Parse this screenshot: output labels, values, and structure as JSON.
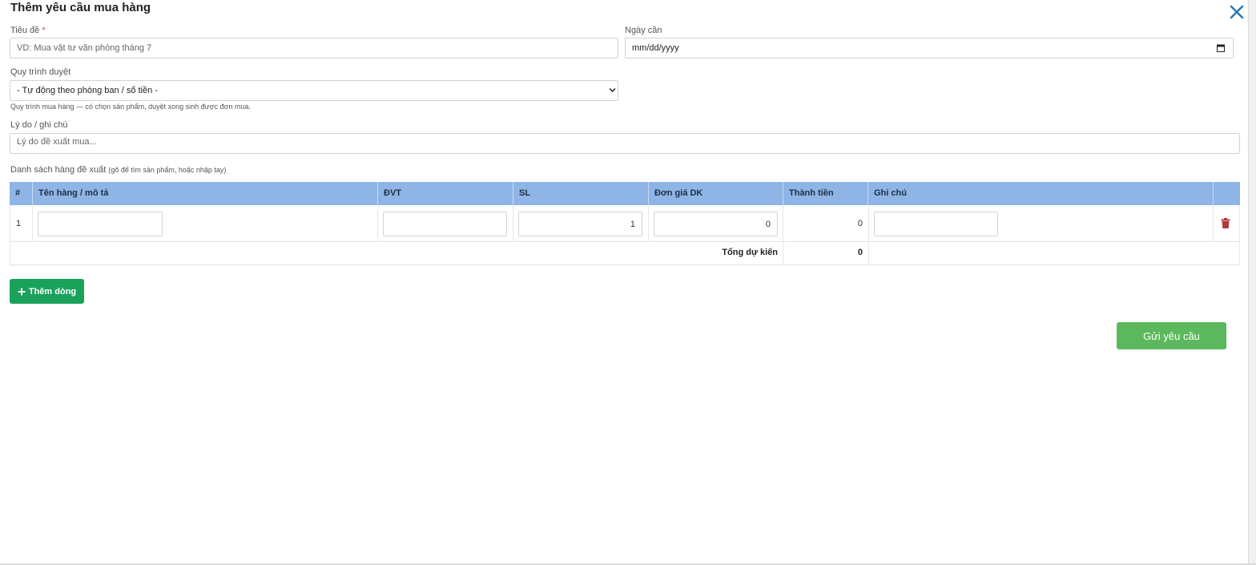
{
  "modal": {
    "title": "Thêm yêu cầu mua hàng"
  },
  "form": {
    "title_label": "Tiêu đề",
    "title_required_mark": "*",
    "title_placeholder": "VD: Mua vật tư văn phòng tháng 7",
    "date_label": "Ngày cần",
    "date_placeholder": "mm/dd/yyyy",
    "workflow_label": "Quy trình duyệt",
    "workflow_selected": "- Tự động theo phòng ban / số tiền -",
    "workflow_hint": "Quy trình mua hàng — có chọn sản phẩm, duyệt xong sinh được đơn mua.",
    "reason_label": "Lý do / ghi chú",
    "reason_placeholder": "Lý do đề xuất mua...",
    "items_label": "Danh sách hàng đề xuất",
    "items_hint": "(gõ để tìm sản phẩm, hoặc nhập tay)"
  },
  "table": {
    "headers": [
      "#",
      "Tên hàng / mô tả",
      "ĐVT",
      "SL",
      "Đơn giá DK",
      "Thành tiền",
      "Ghi chú",
      ""
    ],
    "rows": [
      {
        "index": "1",
        "name": "",
        "unit": "",
        "qty": "1",
        "price": "0",
        "total": "0",
        "note": ""
      }
    ],
    "total_label": "Tổng dự kiến",
    "total_value": "0"
  },
  "buttons": {
    "add_row": "Thêm dòng",
    "submit": "Gửi yêu cầu"
  },
  "colors": {
    "header_bg": "#8eb5e5",
    "add_button": "#1aa15a",
    "submit_button": "#5cb85c",
    "close_icon": "#2b7bb8",
    "delete_icon": "#b23b3b"
  }
}
